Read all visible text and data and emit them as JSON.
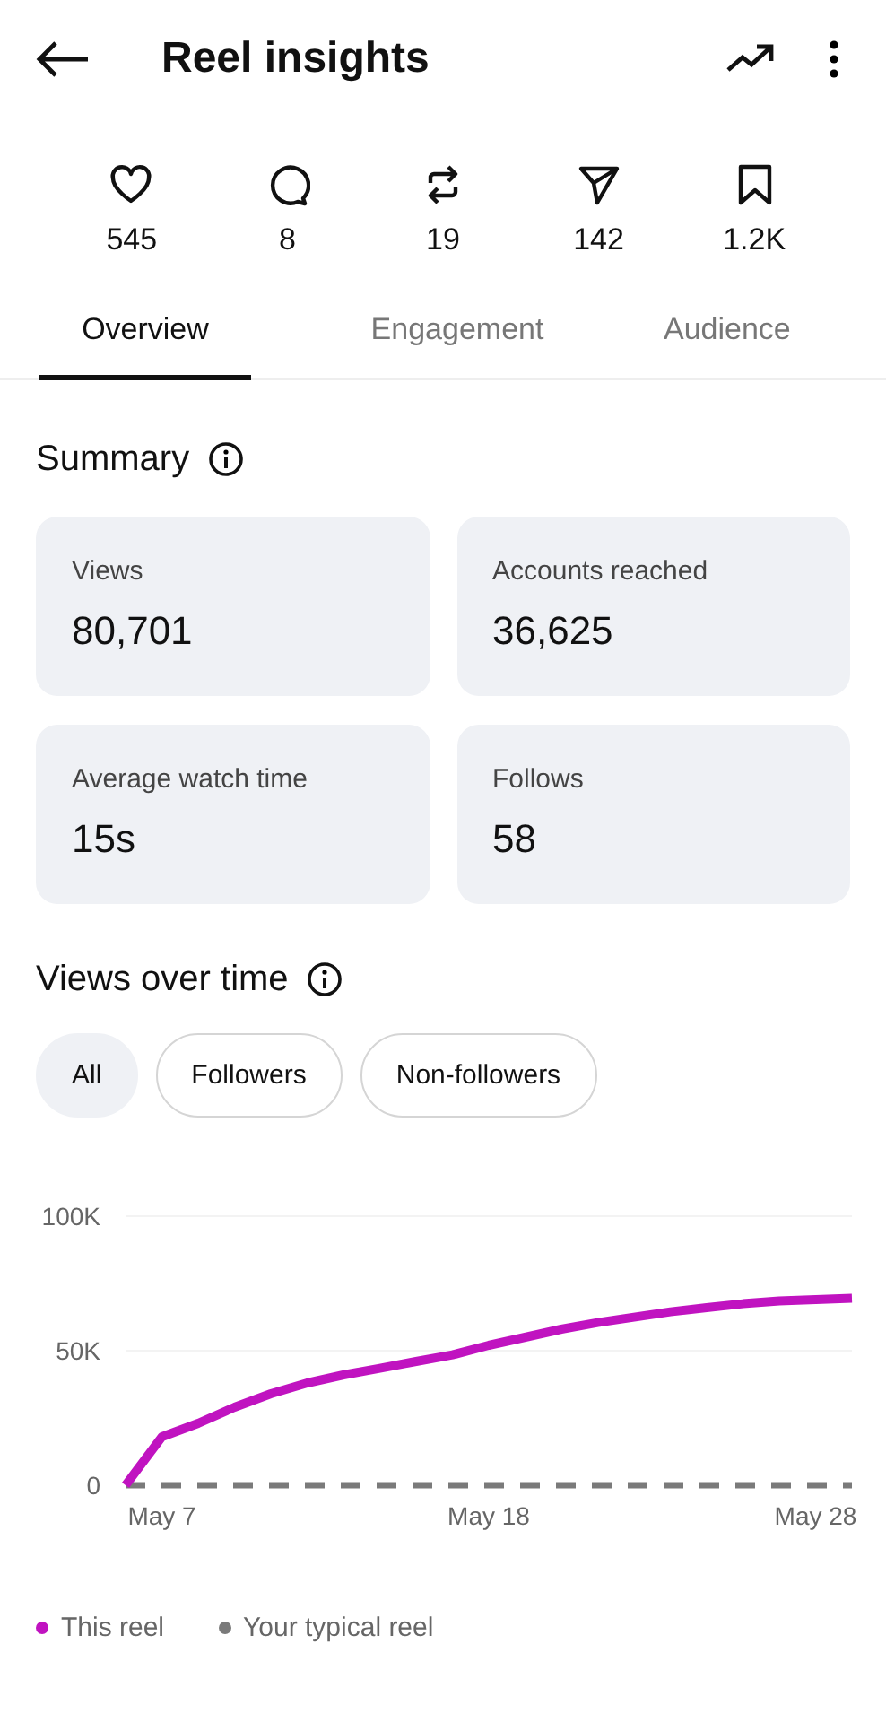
{
  "header": {
    "title": "Reel insights"
  },
  "stats": [
    {
      "kind": "likes",
      "value": "545"
    },
    {
      "kind": "comments",
      "value": "8"
    },
    {
      "kind": "reposts",
      "value": "19"
    },
    {
      "kind": "shares",
      "value": "142"
    },
    {
      "kind": "saves",
      "value": "1.2K"
    }
  ],
  "tabs": [
    {
      "label": "Overview",
      "selected": true
    },
    {
      "label": "Engagement",
      "selected": false
    },
    {
      "label": "Audience",
      "selected": false
    }
  ],
  "summary": {
    "title": "Summary",
    "cards": [
      {
        "label": "Views",
        "value": "80,701"
      },
      {
        "label": "Accounts reached",
        "value": "36,625"
      },
      {
        "label": "Average watch time",
        "value": "15s"
      },
      {
        "label": "Follows",
        "value": "58"
      }
    ]
  },
  "views_over_time": {
    "title": "Views over time",
    "filters": [
      {
        "label": "All",
        "selected": true
      },
      {
        "label": "Followers",
        "selected": false
      },
      {
        "label": "Non-followers",
        "selected": false
      }
    ],
    "chart_data": {
      "type": "line",
      "categories": [
        null,
        "May 7",
        null,
        null,
        null,
        null,
        null,
        null,
        null,
        null,
        "May 18",
        null,
        null,
        null,
        null,
        null,
        null,
        null,
        null,
        "May 28",
        null
      ],
      "ylim": [
        0,
        100000
      ],
      "yticks": [
        {
          "value": 0,
          "label": "0"
        },
        {
          "value": 50000,
          "label": "50K"
        },
        {
          "value": 100000,
          "label": "100K"
        }
      ],
      "series": [
        {
          "name": "This reel",
          "color": "#c013c0",
          "line_style": "solid",
          "values": [
            0,
            18000,
            23000,
            29000,
            34000,
            38000,
            41000,
            43500,
            46000,
            48500,
            52000,
            55000,
            58000,
            60500,
            62500,
            64500,
            66000,
            67500,
            68500,
            69000,
            69500
          ]
        },
        {
          "name": "Your typical reel",
          "color": "#7a7a7a",
          "line_style": "dashed",
          "values": [
            0,
            0,
            0,
            0,
            0,
            0,
            0,
            0,
            0,
            0,
            0,
            0,
            0,
            0,
            0,
            0,
            0,
            0,
            0,
            0,
            0
          ]
        }
      ]
    }
  }
}
